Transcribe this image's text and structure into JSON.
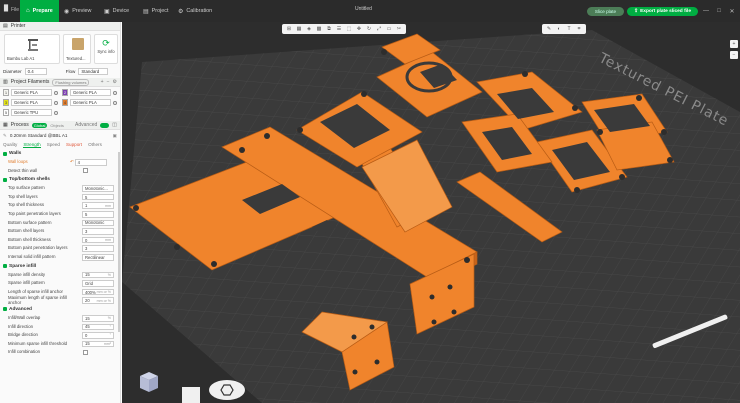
{
  "titlebar": {
    "logo": "▉",
    "file_menu": "File",
    "tabs": [
      {
        "label": "Prepare",
        "icon": "home-icon",
        "glyph": "⌂"
      },
      {
        "label": "Preview",
        "icon": "preview-icon",
        "glyph": "◉"
      },
      {
        "label": "Device",
        "icon": "device-icon",
        "glyph": "▣"
      },
      {
        "label": "Project",
        "icon": "project-icon",
        "glyph": "▤"
      },
      {
        "label": "Calibration",
        "icon": "calibration-icon",
        "glyph": "⚙"
      }
    ],
    "window_title": "Untitled",
    "slice_label": "Slice plate",
    "export_label": "Export plate sliced file",
    "window_controls": [
      "—",
      "□",
      "✕"
    ]
  },
  "printer": {
    "section_title": "Printer",
    "printer_name": "Bambu Lab A1",
    "plate_name": "Textured...",
    "sync_label": "Sync info",
    "diameter_label": "Diameter",
    "diameter_value": "0.4",
    "flow_label": "Flow",
    "flow_value": "Standard"
  },
  "filaments": {
    "section_title": "Project Filaments",
    "flush_label": "Flushing volumes",
    "items": [
      {
        "num": "1",
        "name": "Generic PLA",
        "color": "#f5f5f0"
      },
      {
        "num": "2",
        "name": "Generic PLA",
        "color": "#7b3fb0"
      },
      {
        "num": "3",
        "name": "Generic PLA",
        "color": "#e3e31a"
      },
      {
        "num": "4",
        "name": "Generic PLA",
        "color": "#e07b2a"
      },
      {
        "num": "5",
        "name": "Generic TPU",
        "color": "#ffffff"
      }
    ]
  },
  "process": {
    "section_title": "Process",
    "mode_global": "Global",
    "mode_objects": "Objects",
    "advanced_label": "Advanced",
    "preset": "0.20mm Standard @BBL A1",
    "tabs": [
      "Quality",
      "Strength",
      "Speed",
      "Support",
      "Others"
    ],
    "active_tab": "Strength",
    "groups": [
      {
        "title": "Walls",
        "params": [
          {
            "label": "Wall loops",
            "value": "4",
            "unit": "",
            "highlight": true
          },
          {
            "label": "Detect thin wall",
            "checkbox": true
          }
        ]
      },
      {
        "title": "Top/bottom shells",
        "params": [
          {
            "label": "Top surface pattern",
            "value": "Monotonic...",
            "unit": ""
          },
          {
            "label": "Top shell layers",
            "value": "5",
            "unit": ""
          },
          {
            "label": "Top shell thickness",
            "value": "1",
            "unit": "mm"
          },
          {
            "label": "Top paint penetration layers",
            "value": "5",
            "unit": ""
          },
          {
            "label": "Bottom surface pattern",
            "value": "Monotonic",
            "unit": ""
          },
          {
            "label": "Bottom shell layers",
            "value": "3",
            "unit": ""
          },
          {
            "label": "Bottom shell thickness",
            "value": "0",
            "unit": "mm"
          },
          {
            "label": "Bottom paint penetration layers",
            "value": "3",
            "unit": ""
          },
          {
            "label": "Internal solid infill pattern",
            "value": "Rectilinear",
            "unit": ""
          }
        ]
      },
      {
        "title": "Sparse infill",
        "params": [
          {
            "label": "Sparse infill density",
            "value": "15",
            "unit": "%"
          },
          {
            "label": "Sparse infill pattern",
            "value": "Grid",
            "unit": ""
          },
          {
            "label": "Length of sparse infill anchor",
            "value": "400%",
            "unit": "mm or %"
          },
          {
            "label": "Maximum length of sparse infill anchor",
            "value": "20",
            "unit": "mm or %"
          }
        ]
      },
      {
        "title": "Advanced",
        "params": [
          {
            "label": "Infill/Wall overlap",
            "value": "15",
            "unit": "%"
          },
          {
            "label": "Infill direction",
            "value": "45",
            "unit": "°"
          },
          {
            "label": "Bridge direction",
            "value": "0",
            "unit": "°"
          },
          {
            "label": "Minimum sparse infill threshold",
            "value": "15",
            "unit": "mm²"
          },
          {
            "label": "Infill combination",
            "checkbox": true
          }
        ]
      }
    ]
  },
  "viewport": {
    "plate_label": "Textured PEI Plate",
    "part_color": "#f0842c",
    "bed_color": "#3a3a3a",
    "grid_color": "#4d4d4d"
  },
  "colors": {
    "accent": "#00ae42",
    "titlebar": "#2b2b2b"
  }
}
